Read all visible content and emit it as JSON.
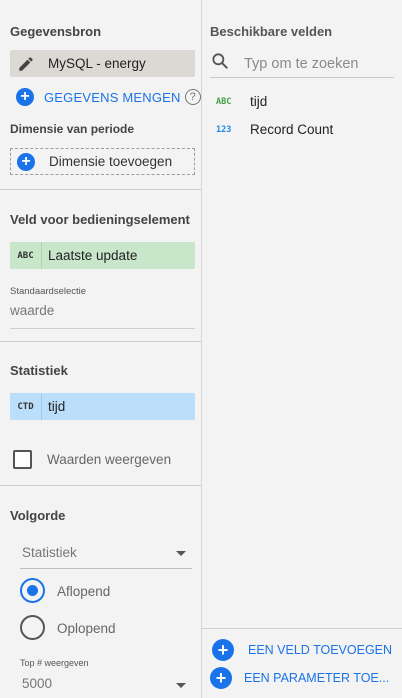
{
  "data_source": {
    "heading": "Gegevensbron",
    "source_name": "MySQL - energy",
    "blend_label": "GEGEVENS MENGEN",
    "help_glyph": "?"
  },
  "date_dimension": {
    "heading": "Dimensie van periode",
    "add_label": "Dimensie toevoegen"
  },
  "control_field": {
    "heading": "Veld voor bedieningselement",
    "field_type": "ABC",
    "field_name": "Laatste update",
    "default_label": "Standaardselectie",
    "default_value": "waarde"
  },
  "metric": {
    "heading": "Statistiek",
    "field_type": "CTD",
    "field_name": "tijd",
    "show_values_label": "Waarden weergeven",
    "show_values_checked": false
  },
  "order": {
    "heading": "Volgorde",
    "sort_field": "Statistiek",
    "options": [
      {
        "label": "Aflopend",
        "checked": true
      },
      {
        "label": "Oplopend",
        "checked": false
      }
    ],
    "top_label": "Top # weergeven",
    "top_value": "5000"
  },
  "available_fields": {
    "heading": "Beschikbare velden",
    "search_placeholder": "Typ om te zoeken",
    "fields": [
      {
        "type": "ABC",
        "name": "tijd"
      },
      {
        "type": "123",
        "name": "Record Count"
      }
    ],
    "add_field_label": "EEN VELD TOEVOEGEN",
    "add_parameter_label": "EEN PARAMETER TOE..."
  },
  "colors": {
    "accent": "#1a73e8",
    "text_field_chip": "#c8e6c9",
    "metric_chip": "#bbdefb",
    "source_chip": "#dcd8d4"
  }
}
